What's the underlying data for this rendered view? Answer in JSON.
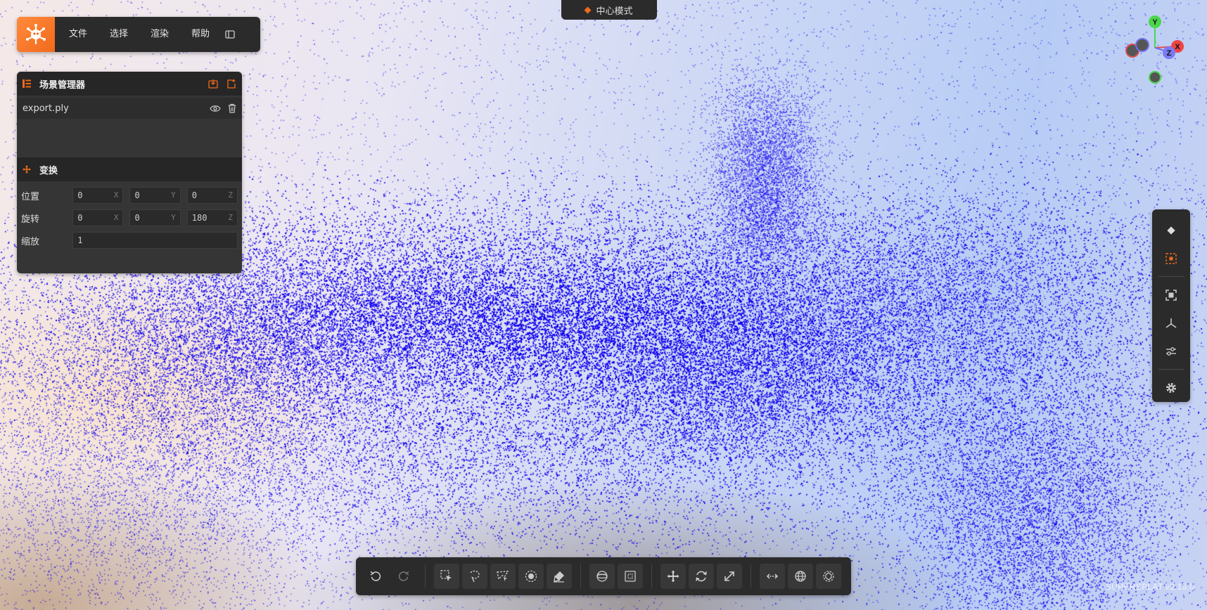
{
  "menu": {
    "items": [
      "文件",
      "选择",
      "渲染",
      "帮助"
    ]
  },
  "mode": {
    "label": "中心模式"
  },
  "scene": {
    "title": "场景管理器",
    "file": "export.ply"
  },
  "transform": {
    "title": "变换",
    "position": {
      "label": "位置",
      "x": "0",
      "y": "0",
      "z": "0"
    },
    "rotation": {
      "label": "旋转",
      "x": "0",
      "y": "0",
      "z": "180"
    },
    "scale": {
      "label": "缩放",
      "value": "1"
    },
    "axes": {
      "x": "X",
      "y": "Y",
      "z": "Z"
    }
  },
  "gizmo": {
    "y": "Y",
    "x": "X",
    "z": "Z"
  },
  "version": "SUPERSPLAT v2.15.0",
  "colors": {
    "accent": "#f26a1b",
    "splat_points": "#1400f0",
    "panel": "#2b2b2b"
  }
}
